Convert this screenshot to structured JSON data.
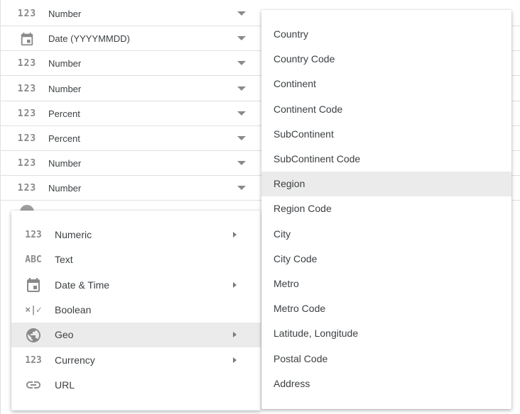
{
  "fields": [
    {
      "icon": "123",
      "icon_name": "numeric-icon",
      "type": "Number"
    },
    {
      "icon": "calendar",
      "icon_name": "calendar-icon",
      "type": "Date (YYYYMMDD)"
    },
    {
      "icon": "123",
      "icon_name": "numeric-icon",
      "type": "Number"
    },
    {
      "icon": "123",
      "icon_name": "numeric-icon",
      "type": "Number"
    },
    {
      "icon": "123",
      "icon_name": "numeric-icon",
      "type": "Percent"
    },
    {
      "icon": "123",
      "icon_name": "numeric-icon",
      "type": "Percent"
    },
    {
      "icon": "123",
      "icon_name": "numeric-icon",
      "type": "Number"
    },
    {
      "icon": "123",
      "icon_name": "numeric-icon",
      "type": "Number"
    }
  ],
  "type_menu": {
    "items": [
      {
        "label": "Numeric",
        "icon": "123",
        "icon_name": "numeric-icon",
        "has_submenu": true
      },
      {
        "label": "Text",
        "icon": "ABC",
        "icon_name": "text-icon",
        "has_submenu": false
      },
      {
        "label": "Date & Time",
        "icon": "calendar",
        "icon_name": "calendar-icon",
        "has_submenu": true
      },
      {
        "label": "Boolean",
        "icon": "×|✓",
        "icon_name": "boolean-icon",
        "has_submenu": false
      },
      {
        "label": "Geo",
        "icon": "globe",
        "icon_name": "globe-icon",
        "has_submenu": true,
        "active": true
      },
      {
        "label": "Currency",
        "icon": "123",
        "icon_name": "numeric-icon",
        "has_submenu": true
      },
      {
        "label": "URL",
        "icon": "link",
        "icon_name": "link-icon",
        "has_submenu": false
      }
    ]
  },
  "geo_menu": {
    "items": [
      {
        "label": "Country"
      },
      {
        "label": "Country Code"
      },
      {
        "label": "Continent"
      },
      {
        "label": "Continent Code"
      },
      {
        "label": "SubContinent"
      },
      {
        "label": "SubContinent Code"
      },
      {
        "label": "Region",
        "active": true
      },
      {
        "label": "Region Code"
      },
      {
        "label": "City"
      },
      {
        "label": "City Code"
      },
      {
        "label": "Metro"
      },
      {
        "label": "Metro Code"
      },
      {
        "label": "Latitude, Longitude"
      },
      {
        "label": "Postal Code"
      },
      {
        "label": "Address"
      }
    ]
  },
  "colors": {
    "icon": "#8a8a8a",
    "text": "#3c4043",
    "hover": "#ebebeb",
    "divider": "#e0e0e0"
  }
}
